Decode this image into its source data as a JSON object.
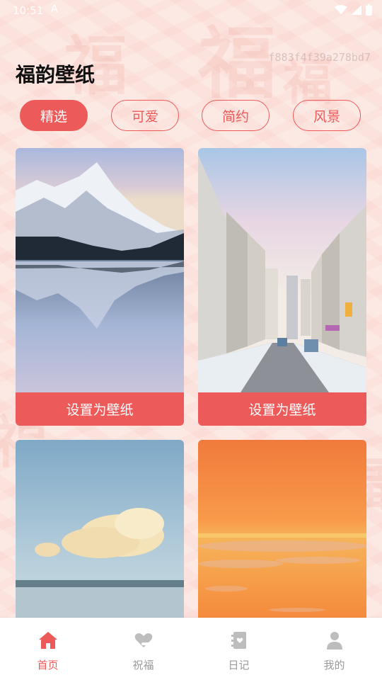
{
  "status_bar": {
    "time": "10:51",
    "indicator": "A"
  },
  "watermark_text": "f883f4f39a278bd7",
  "app_title": "福韵壁纸",
  "tabs": [
    {
      "label": "精选",
      "active": true
    },
    {
      "label": "可爱",
      "active": false
    },
    {
      "label": "简约",
      "active": false
    },
    {
      "label": "风景",
      "active": false
    }
  ],
  "cards": [
    {
      "image": "mountain-lake-reflection",
      "button_label": "设置为壁纸"
    },
    {
      "image": "city-street-winter",
      "button_label": "设置为壁纸"
    },
    {
      "image": "cloud-over-sea",
      "button_label": null
    },
    {
      "image": "orange-sunset-sea",
      "button_label": null
    }
  ],
  "bottom_nav": [
    {
      "label": "首页",
      "icon": "home-icon",
      "active": true
    },
    {
      "label": "祝福",
      "icon": "heart-hand-icon",
      "active": false
    },
    {
      "label": "日记",
      "icon": "diary-icon",
      "active": false
    },
    {
      "label": "我的",
      "icon": "user-icon",
      "active": false
    }
  ],
  "colors": {
    "accent": "#ec5a5a",
    "background": "#fde9e4",
    "nav_inactive": "#9a9a9a"
  }
}
